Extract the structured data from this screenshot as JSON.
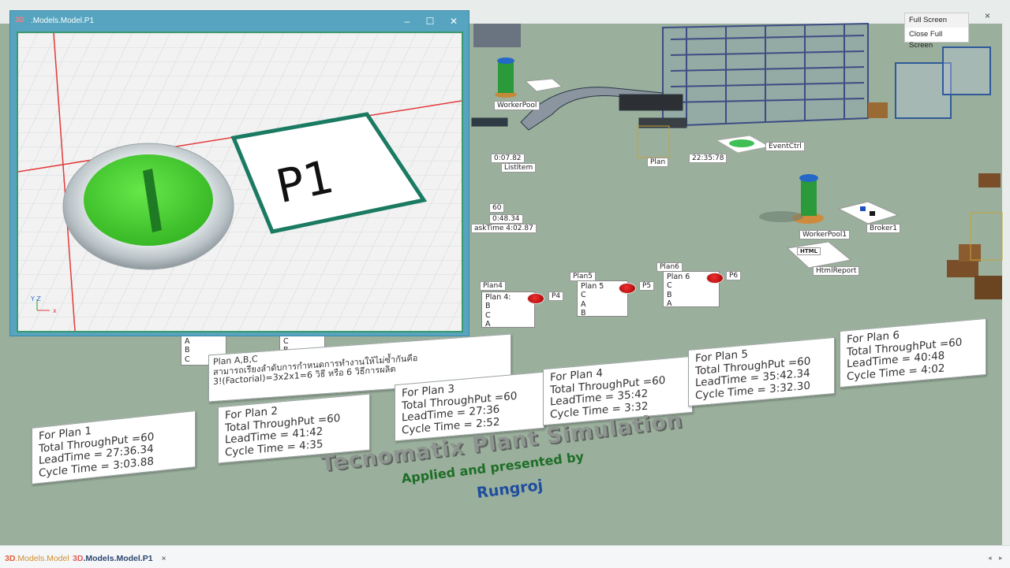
{
  "window": {
    "title": ".Models.Model.P1",
    "icon_text": "3D",
    "axis_x": "x",
    "axis_yz": "Y Z",
    "p1_label": "P1"
  },
  "scene_menu": {
    "items": [
      "Full Screen",
      "Close Full Screen"
    ],
    "close_glyph": "×"
  },
  "tabs": [
    {
      "prefix": "3D",
      "label": ".Models.Model"
    },
    {
      "prefix": "3D",
      "label": ".Models.Model.P1",
      "close": "×"
    }
  ],
  "tab_nav": {
    "left": "◂",
    "right": "▸"
  },
  "object_labels": {
    "worker": "WorkerPool",
    "worker_pool1": "WorkerPool1",
    "broker1": "Broker1",
    "html_report": "HtmlReport",
    "html_icon": "HTML",
    "event_time": "22:35:78",
    "event_label": "EventCtrl",
    "stat_sec": "0:07.82",
    "stat_60": "60",
    "stat_48": "0:48.34",
    "task_time": "askTime  4:02.87",
    "small_label_1": "ListItem",
    "small_label_2": "Plan"
  },
  "plans": {
    "tags": [
      "Plan4",
      "Plan5",
      "Plan6"
    ],
    "blocks": [
      {
        "head": "Plan 4:",
        "items": [
          "B",
          "C",
          "A"
        ]
      },
      {
        "head": "Plan 5",
        "items": [
          "C",
          "A",
          "B"
        ]
      },
      {
        "head": "Plan 6",
        "items": [
          "C",
          "B",
          "A"
        ]
      }
    ],
    "signals": [
      "P4",
      "P5",
      "P6"
    ]
  },
  "left_partial_blocks": {
    "b1": [
      "A",
      "B",
      "C"
    ],
    "b2": [
      "C",
      "B"
    ]
  },
  "intro_note": {
    "line1": "Plan A,B,C",
    "line2": "สามารถเรียงลำดับการกำหนดการทำงานให้ไม่ซ้ำกันคือ",
    "line3": "3!(Factorial)=3x2x1=6 วิธี หรือ 6 วิธีการผลิต"
  },
  "results": [
    {
      "plan": "For Plan 1",
      "throughput": "Total ThroughPut =60",
      "lead": "LeadTime = 27:36.34",
      "cycle": "Cycle Time = 3:03.88"
    },
    {
      "plan": "For Plan 2",
      "throughput": "Total ThroughPut =60",
      "lead": "LeadTime = 41:42",
      "cycle": "Cycle Time = 4:35"
    },
    {
      "plan": "For Plan 3",
      "throughput": "Total ThroughPut =60",
      "lead": "LeadTime = 27:36",
      "cycle": "Cycle Time = 2:52"
    },
    {
      "plan": "For Plan 4",
      "throughput": "Total ThroughPut =60",
      "lead": "LeadTime = 35:42",
      "cycle": "Cycle Time = 3:32"
    },
    {
      "plan": "For Plan 5",
      "throughput": "Total ThroughPut =60",
      "lead": "LeadTime = 35:42.34",
      "cycle": "Cycle Time = 3:32.30"
    },
    {
      "plan": "For Plan 6",
      "throughput": "Total ThroughPut =60",
      "lead": "LeadTime = 40:48",
      "cycle": "Cycle Time = 4:02"
    }
  ],
  "title_3d": {
    "main": "Tecnomatix Plant Simulation",
    "sub": "Applied and presented by",
    "author": "Rungroj"
  },
  "colors": {
    "floor": "#9aaf9c",
    "window_frame": "#56a4bf",
    "button_green": "#52d83a",
    "title_green": "#1e6e28",
    "author_blue": "#1f4e9e"
  }
}
